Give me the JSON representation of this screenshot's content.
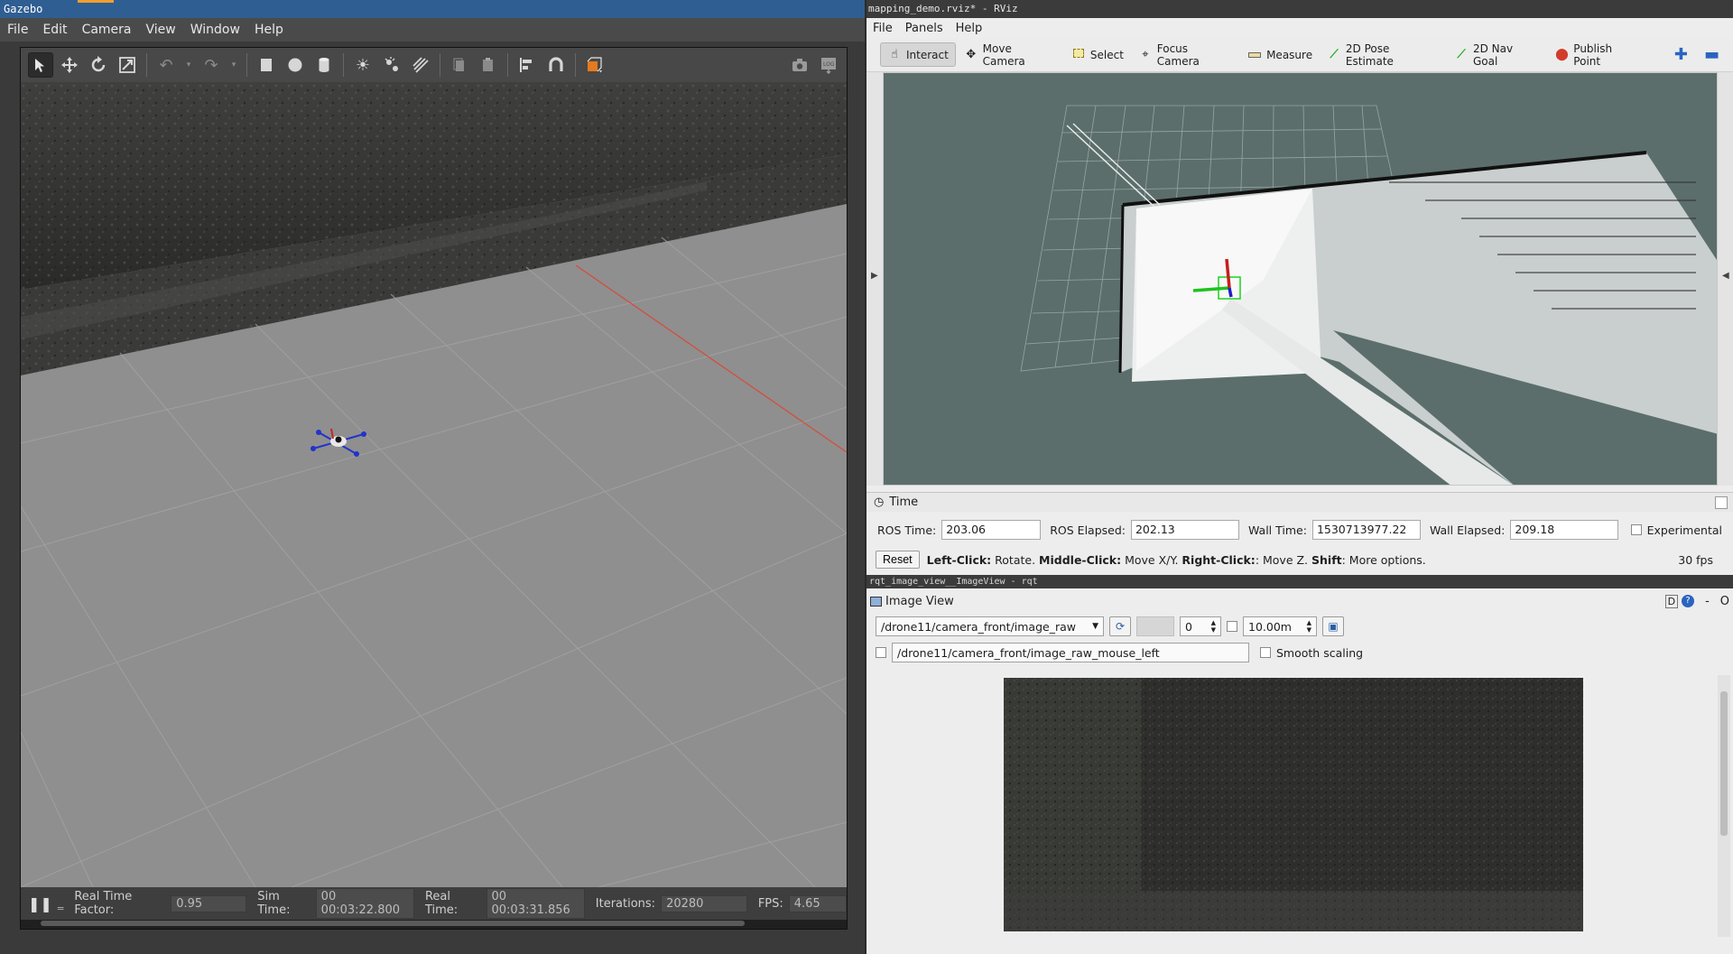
{
  "gazebo": {
    "title": "Gazebo",
    "menu": [
      "File",
      "Edit",
      "Camera",
      "View",
      "Window",
      "Help"
    ],
    "toolbar_icons": [
      "select-arrow-icon",
      "translate-icon",
      "rotate-icon",
      "scale-icon",
      "undo-icon",
      "redo-icon",
      "box-icon",
      "sphere-icon",
      "cylinder-icon",
      "point-light-icon",
      "spot-light-icon",
      "directional-light-icon",
      "copy-icon",
      "paste-icon",
      "align-icon",
      "snap-icon",
      "view-angle-icon",
      "screenshot-icon",
      "log-icon"
    ],
    "status": {
      "pause_icon": "pause-icon",
      "real_time_factor_label": "Real Time Factor:",
      "real_time_factor": "0.95",
      "sim_time_label": "Sim Time:",
      "sim_time": "00 00:03:22.800",
      "real_time_label": "Real Time:",
      "real_time": "00 00:03:31.856",
      "iterations_label": "Iterations:",
      "iterations": "20280",
      "fps_label": "FPS:",
      "fps": "4.65"
    }
  },
  "rviz": {
    "title": "mapping_demo.rviz* - RViz",
    "menu": [
      "File",
      "Panels",
      "Help"
    ],
    "tools": [
      {
        "label": "Interact",
        "icon": "hand-icon",
        "selected": true
      },
      {
        "label": "Move Camera",
        "icon": "move-camera-icon",
        "selected": false
      },
      {
        "label": "Select",
        "icon": "select-box-icon",
        "selected": false
      },
      {
        "label": "Focus Camera",
        "icon": "focus-icon",
        "selected": false
      },
      {
        "label": "Measure",
        "icon": "ruler-icon",
        "selected": false
      },
      {
        "label": "2D Pose Estimate",
        "icon": "green-arrow-icon",
        "selected": false
      },
      {
        "label": "2D Nav Goal",
        "icon": "green-arrow-icon",
        "selected": false
      },
      {
        "label": "Publish Point",
        "icon": "map-pin-icon",
        "selected": false
      }
    ],
    "time_panel": {
      "title": "Time",
      "ros_time_label": "ROS Time:",
      "ros_time": "203.06",
      "ros_elapsed_label": "ROS Elapsed:",
      "ros_elapsed": "202.13",
      "wall_time_label": "Wall Time:",
      "wall_time": "1530713977.22",
      "wall_elapsed_label": "Wall Elapsed:",
      "wall_elapsed": "209.18",
      "experimental_label": "Experimental"
    },
    "hint": {
      "reset": "Reset",
      "left_click": "Left-Click:",
      "left_desc": "Rotate.",
      "middle_click": "Middle-Click:",
      "middle_desc": "Move X/Y.",
      "right_click": "Right-Click:",
      "right_desc": ": Move Z.",
      "shift": "Shift",
      "shift_desc": ": More options.",
      "fps": "30 fps"
    }
  },
  "rqt": {
    "title": "rqt_image_view__ImageView - rqt",
    "panel_title": "Image View",
    "topic": "/drone11/camera_front/image_raw",
    "zero_value": "0",
    "max_value": "10.00m",
    "mouse_topic": "/drone11/camera_front/image_raw_mouse_left",
    "smooth_scaling_label": "Smooth scaling",
    "hdr_buttons": [
      "D",
      "?",
      "-",
      "O"
    ]
  }
}
